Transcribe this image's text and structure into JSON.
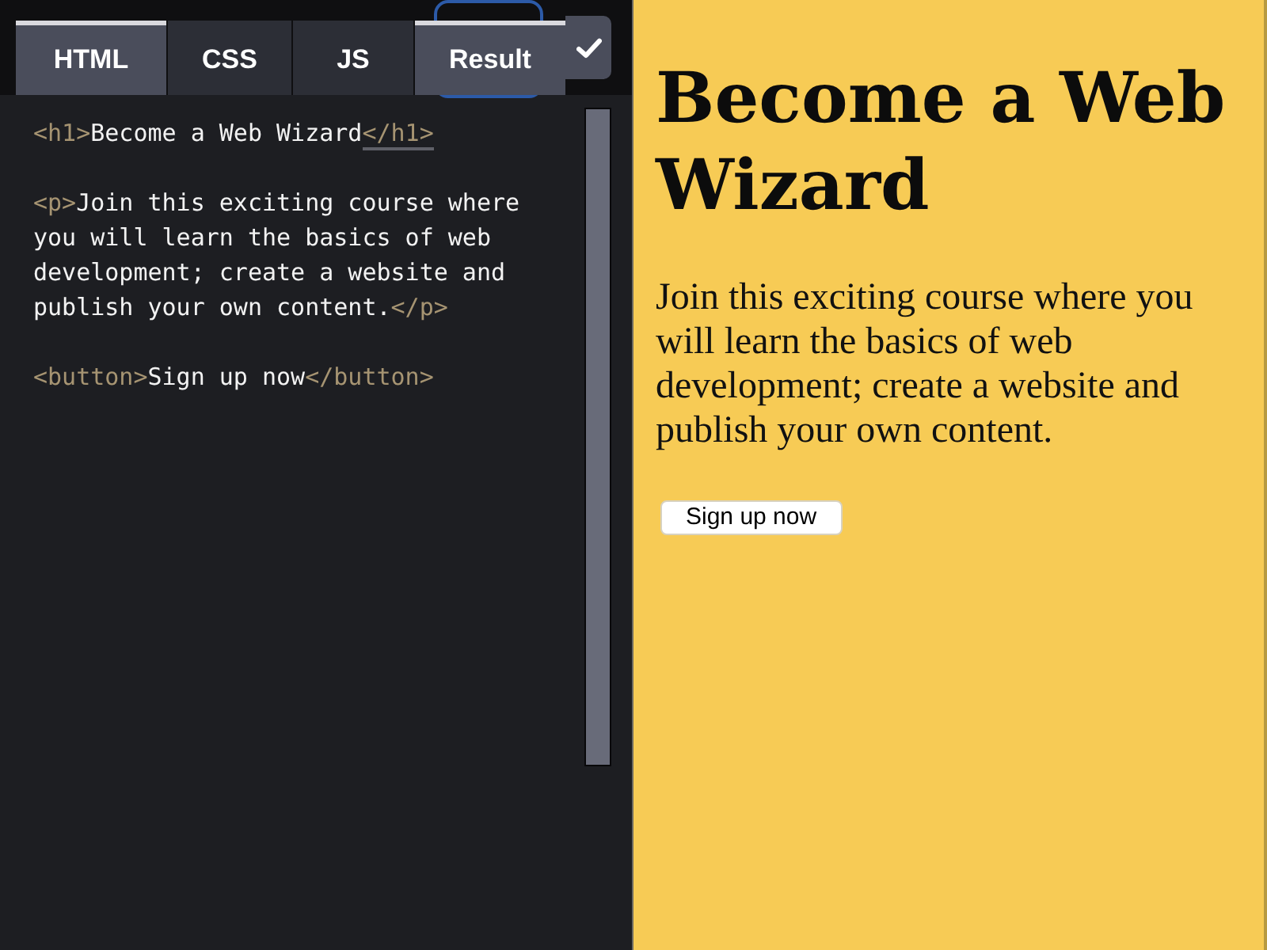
{
  "editor": {
    "tabs": [
      {
        "label": "HTML",
        "selected": true,
        "focused": false
      },
      {
        "label": "CSS",
        "selected": false,
        "focused": false
      },
      {
        "label": "JS",
        "selected": false,
        "focused": false
      },
      {
        "label": "Result",
        "selected": true,
        "focused": true
      }
    ],
    "code": [
      {
        "lines": [
          {
            "tokens": [
              {
                "kind": "tag",
                "text": "<h1>",
                "underlined": false
              },
              {
                "kind": "text",
                "text": "Become a Web Wizard",
                "underlined": false
              },
              {
                "kind": "tag",
                "text": "</h1>",
                "underlined": true
              }
            ]
          }
        ]
      },
      {
        "lines": [
          {
            "tokens": [
              {
                "kind": "tag",
                "text": "<p>",
                "underlined": false
              },
              {
                "kind": "text",
                "text": "Join this exciting course where",
                "underlined": false
              }
            ]
          },
          {
            "tokens": [
              {
                "kind": "text",
                "text": "you will learn the basics of web",
                "underlined": false
              }
            ]
          },
          {
            "tokens": [
              {
                "kind": "text",
                "text": "development; create a website and",
                "underlined": false
              }
            ]
          },
          {
            "tokens": [
              {
                "kind": "text",
                "text": "publish your own content.",
                "underlined": false
              },
              {
                "kind": "tag",
                "text": "</p>",
                "underlined": false
              }
            ]
          }
        ]
      },
      {
        "lines": [
          {
            "tokens": [
              {
                "kind": "tag",
                "text": "<button>",
                "underlined": false
              },
              {
                "kind": "text",
                "text": "Sign up now",
                "underlined": false
              },
              {
                "kind": "tag",
                "text": "</button>",
                "underlined": false
              }
            ]
          }
        ]
      }
    ]
  },
  "preview": {
    "heading": "Become a Web Wizard",
    "paragraph": "Join this exciting course where you will learn the basics of web development; create a website and publish your own content.",
    "button": "Sign up now"
  }
}
